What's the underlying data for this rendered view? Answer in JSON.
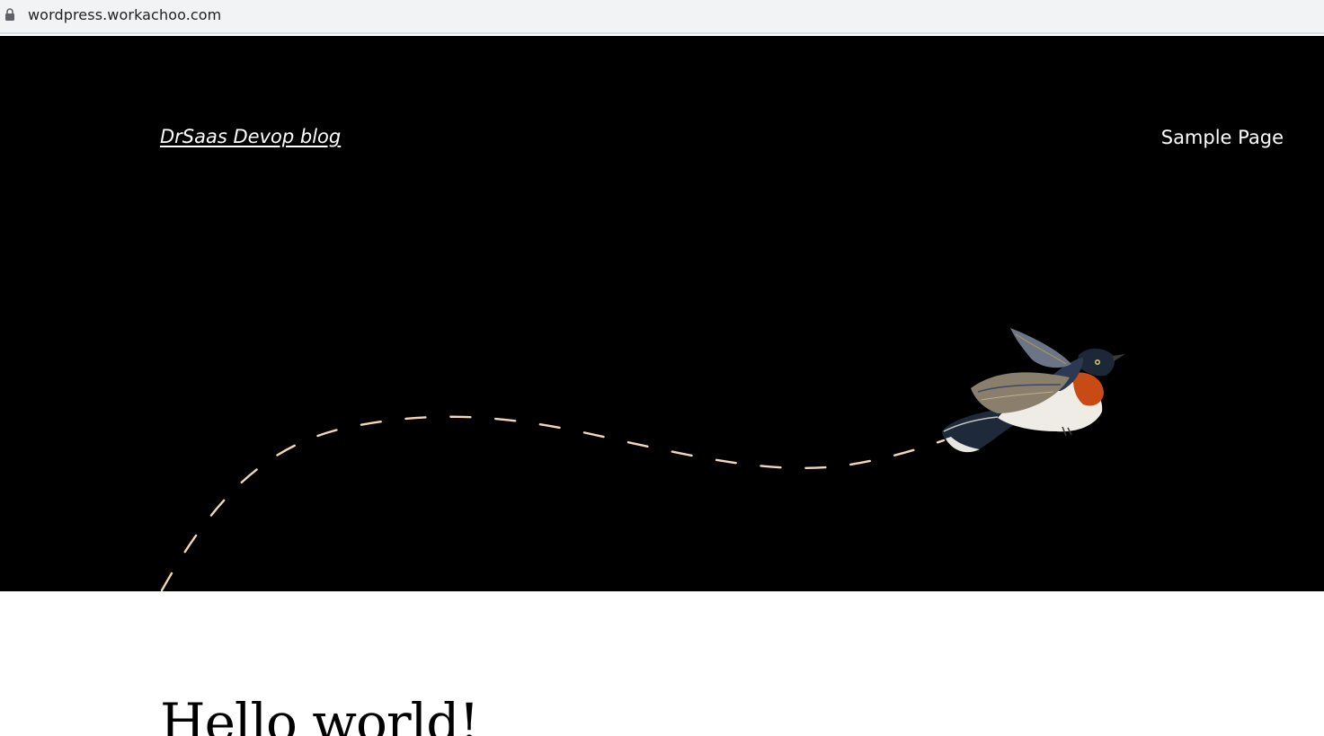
{
  "browser": {
    "url": "wordpress.workachoo.com",
    "icons": {
      "lock": "lock-icon"
    }
  },
  "header": {
    "site_title": "DrSaas Devop blog",
    "nav": [
      {
        "label": "Sample Page"
      }
    ]
  },
  "hero": {
    "background_color": "#000000",
    "path_color": "#f5d7b8",
    "illustration": "bird-illustration"
  },
  "post": {
    "title": "Hello world!"
  }
}
